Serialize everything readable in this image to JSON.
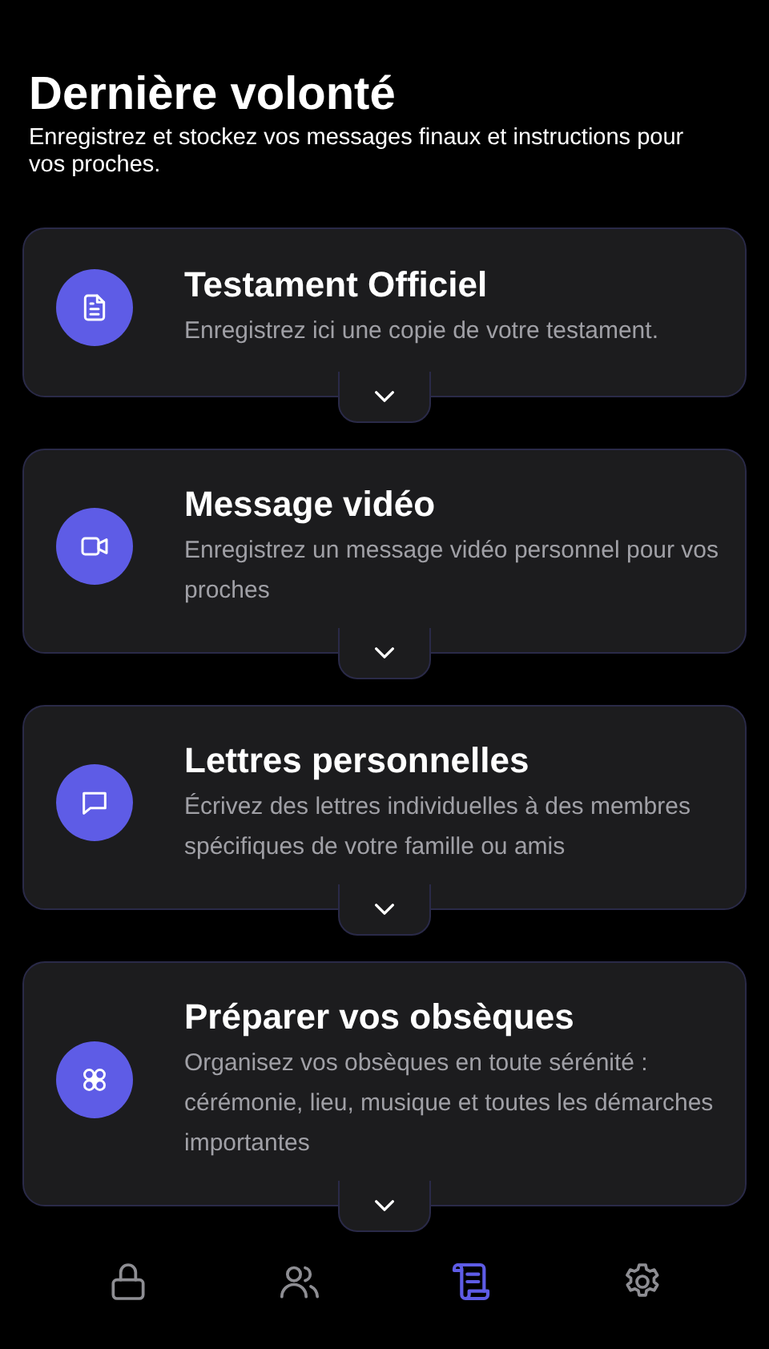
{
  "header": {
    "title": "Dernière volonté",
    "subtitle": "Enregistrez et stockez vos messages finaux et instructions pour vos proches."
  },
  "cards": [
    {
      "title": "Testament Officiel",
      "description": "Enregistrez ici une copie de votre testament.",
      "expanded": false
    },
    {
      "title": "Message vidéo",
      "description": "Enregistrez un message vidéo personnel pour vos proches",
      "expanded": false
    },
    {
      "title": "Lettres personnelles",
      "description": "Écrivez des lettres individuelles à des membres spécifiques de votre famille ou amis",
      "expanded": false
    },
    {
      "title": "Préparer vos obsèques",
      "description": "Organisez vos obsèques en toute sérénité : cérémonie, lieu, musique et toutes les démarches importantes",
      "expanded": false
    }
  ],
  "nav": [
    {
      "selected": false
    },
    {
      "selected": false
    },
    {
      "selected": true
    },
    {
      "selected": false
    }
  ]
}
